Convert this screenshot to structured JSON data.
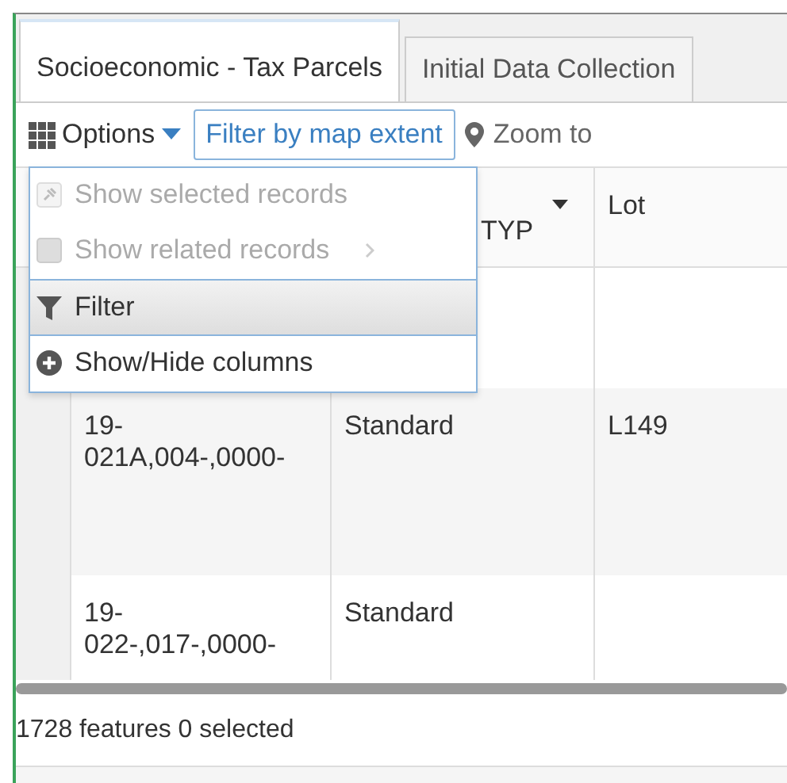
{
  "tabs": [
    {
      "label": "Socioeconomic - Tax Parcels",
      "selected": true
    },
    {
      "label": "Initial Data Collection",
      "selected": false
    }
  ],
  "toolbar": {
    "options": "Options",
    "filter_extent": "Filter by map extent",
    "zoom": "Zoom to"
  },
  "table": {
    "columns": [
      "",
      "TYP",
      "Lot"
    ],
    "rows": [
      {
        "cells": [
          "",
          "",
          ""
        ]
      },
      {
        "cells": [
          "19-\n021A,004-,0000-",
          "Standard",
          "L149"
        ]
      },
      {
        "cells": [
          "19-\n022-,017-,0000-",
          "Standard",
          ""
        ]
      }
    ]
  },
  "menu": {
    "items": [
      {
        "kind": "pin",
        "label": "Show selected records",
        "disabled": true,
        "submenu": false,
        "selected": false
      },
      {
        "kind": "box",
        "label": "Show related records",
        "disabled": true,
        "submenu": true,
        "selected": false
      },
      {
        "kind": "funnel",
        "label": "Filter",
        "disabled": false,
        "submenu": false,
        "selected": true
      },
      {
        "kind": "plus",
        "label": "Show/Hide columns",
        "disabled": false,
        "submenu": false,
        "selected": false
      }
    ]
  },
  "status_bar": "1728 features 0 selected"
}
